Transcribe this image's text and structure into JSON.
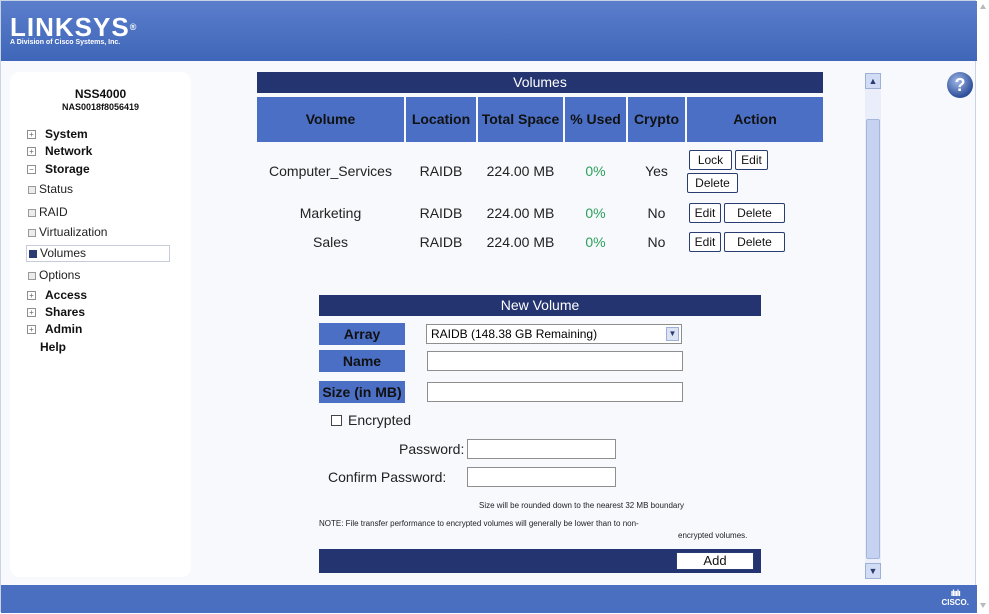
{
  "brand": {
    "name": "LINKSYS",
    "reg": "®",
    "tagline": "A Division of Cisco Systems, Inc."
  },
  "device": {
    "model": "NSS4000",
    "id": "NAS0018f8056419"
  },
  "sidebar": {
    "items": [
      {
        "label": "System",
        "expander": "+"
      },
      {
        "label": "Network",
        "expander": "+"
      },
      {
        "label": "Storage",
        "expander": "−"
      },
      {
        "label": "Status"
      },
      {
        "label": "RAID"
      },
      {
        "label": "Virtualization"
      },
      {
        "label": "Volumes"
      },
      {
        "label": "Options"
      },
      {
        "label": "Access",
        "expander": "+"
      },
      {
        "label": "Shares",
        "expander": "+"
      },
      {
        "label": "Admin",
        "expander": "+"
      },
      {
        "label": "Help"
      }
    ]
  },
  "volumes": {
    "title": "Volumes",
    "headers": {
      "volume": "Volume",
      "location": "Location",
      "total_space": "Total Space",
      "pct_used": "% Used",
      "crypto": "Crypto",
      "action": "Action"
    },
    "rows": [
      {
        "volume": "Computer_Services",
        "location": "RAIDB",
        "total": "224.00 MB",
        "used": "0%",
        "crypto": "Yes",
        "actions": [
          "Lock",
          "Edit",
          "Delete"
        ]
      },
      {
        "volume": "Marketing",
        "location": "RAIDB",
        "total": "224.00 MB",
        "used": "0%",
        "crypto": "No",
        "actions": [
          "Edit",
          "Delete"
        ]
      },
      {
        "volume": "Sales",
        "location": "RAIDB",
        "total": "224.00 MB",
        "used": "0%",
        "crypto": "No",
        "actions": [
          "Edit",
          "Delete"
        ]
      }
    ]
  },
  "new_volume": {
    "title": "New Volume",
    "array_label": "Array",
    "array_value": "RAIDB (148.38 GB Remaining)",
    "name_label": "Name",
    "name_value": "",
    "size_label": "Size (in MB)",
    "size_value": "",
    "encrypted_label": "Encrypted",
    "password_label": "Password:",
    "confirm_label": "Confirm Password:",
    "note_round": "Size will be rounded down to the nearest 32 MB boundary",
    "note_perf_1": "NOTE: File transfer performance to encrypted volumes will generally be lower than to non-",
    "note_perf_2": "encrypted volumes.",
    "add_label": "Add"
  },
  "help_label": "?",
  "footer": {
    "cisco_bars": "ılıılı",
    "cisco_word": "CISCO."
  },
  "colors": {
    "header_dark": "#233470",
    "header_blue": "#4a6fc4",
    "topbar": "#4a6fc0",
    "pct_green": "#2aa05a"
  }
}
